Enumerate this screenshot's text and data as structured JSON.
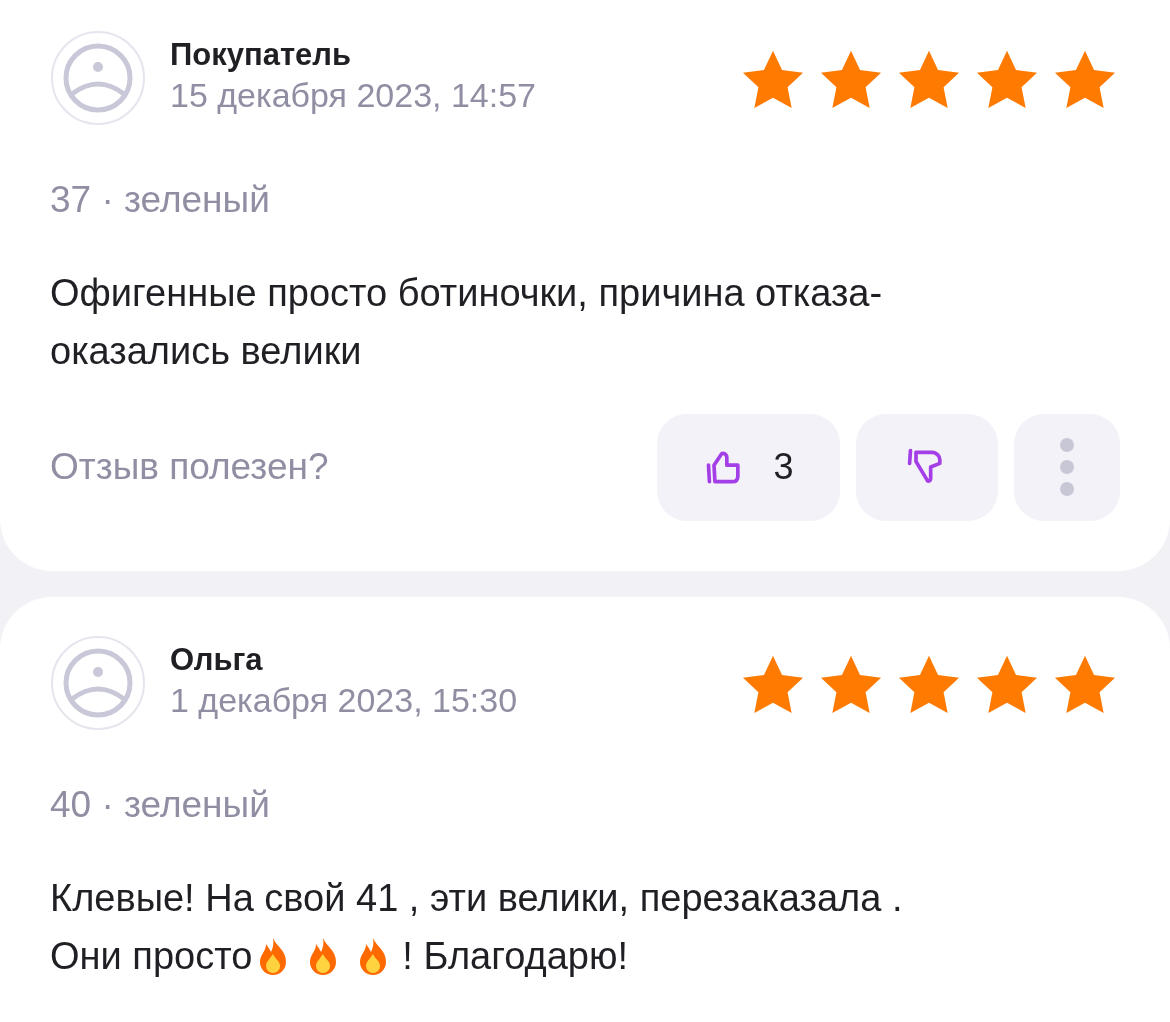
{
  "reviews": [
    {
      "author": "Покупатель",
      "date": "15 декабря 2023, 14:57",
      "stars": 5,
      "variant": "37 · зеленый",
      "body": [
        [
          {
            "kind": "text",
            "text": "Офигенные просто ботиночки, причина отказа-оказались велики"
          }
        ]
      ],
      "helpful": {
        "label": "Отзыв полезен?",
        "likes": "3"
      }
    },
    {
      "author": "Ольга",
      "date": "1 декабря 2023, 15:30",
      "stars": 5,
      "variant": "40 · зеленый",
      "body": [
        [
          {
            "kind": "text",
            "text": "Клевые! На свой 41 , эти велики, перезаказала ."
          }
        ],
        [
          {
            "kind": "text",
            "text": "Они просто"
          },
          {
            "kind": "fire"
          },
          {
            "kind": "fire"
          },
          {
            "kind": "fire"
          },
          {
            "kind": "text",
            "text": "! Благодарю!"
          }
        ]
      ]
    }
  ]
}
